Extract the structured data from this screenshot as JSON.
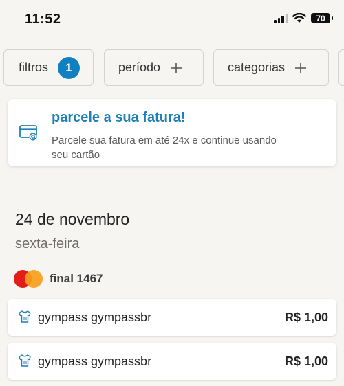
{
  "status_bar": {
    "time": "11:52",
    "battery": "70"
  },
  "filters": {
    "chips": [
      {
        "label": "filtros",
        "badge": "1"
      },
      {
        "label": "período"
      },
      {
        "label": "categorias"
      }
    ]
  },
  "promo": {
    "title": "parcele a sua fatura!",
    "description": "Parcele sua fatura em até 24x e continue usando seu cartão",
    "icon": "credit-card-at-icon"
  },
  "day_group": {
    "date": "24 de novembro",
    "weekday": "sexta-feira",
    "card": {
      "brand": "mastercard",
      "label": "final 1467"
    },
    "transactions": [
      {
        "name": "gympass gympassbr",
        "amount": "R$ 1,00",
        "icon": "shirt-icon"
      },
      {
        "name": "gympass gympassbr",
        "amount": "R$ 1,00",
        "icon": "shirt-icon"
      }
    ]
  },
  "colors": {
    "accent": "#1180c2",
    "promo_title": "#1f7fb7",
    "background": "#f7f5f2"
  }
}
